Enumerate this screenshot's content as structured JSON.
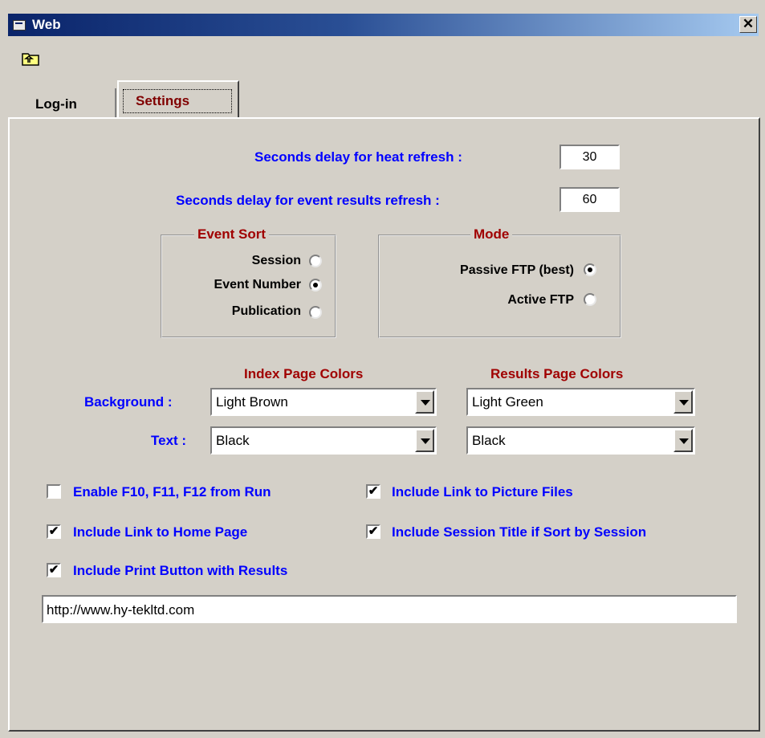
{
  "window": {
    "title": "Web",
    "close_glyph": "✕"
  },
  "toolbar": {
    "icon": "folder-up-icon"
  },
  "tabs": [
    {
      "label": "Log-in",
      "active": false
    },
    {
      "label": "Settings",
      "active": true
    }
  ],
  "settings": {
    "heat_refresh_label": "Seconds delay for heat refresh :",
    "heat_refresh_value": "30",
    "event_refresh_label": "Seconds delay for event results refresh :",
    "event_refresh_value": "60",
    "event_sort": {
      "title": "Event Sort",
      "options": [
        {
          "label": "Session",
          "checked": false
        },
        {
          "label": "Event Number",
          "checked": true
        },
        {
          "label": "Publication",
          "checked": false
        }
      ]
    },
    "mode": {
      "title": "Mode",
      "options": [
        {
          "label": "Passive FTP (best)",
          "checked": true
        },
        {
          "label": "Active FTP",
          "checked": false
        }
      ]
    },
    "index_colors_heading": "Index Page Colors",
    "results_colors_heading": "Results Page Colors",
    "background_label": "Background :",
    "text_label": "Text :",
    "index_background": "Light Brown",
    "index_text": "Black",
    "results_background": "Light Green",
    "results_text": "Black",
    "checkboxes": [
      {
        "label": "Enable F10, F11, F12 from Run",
        "checked": false
      },
      {
        "label": "Include Link to Picture Files",
        "checked": true
      },
      {
        "label": "Include Link to Home Page",
        "checked": true
      },
      {
        "label": "Include Session Title if Sort by Session",
        "checked": true
      },
      {
        "label": "Include Print Button with Results",
        "checked": true
      }
    ],
    "home_url": "http://www.hy-tekltd.com",
    "check_glyph": "✔"
  },
  "colors": {
    "window_bg": "#d4d0c8",
    "label_blue": "#0000ff",
    "heading_red": "#a00000",
    "title_bar": "#0a246a"
  }
}
